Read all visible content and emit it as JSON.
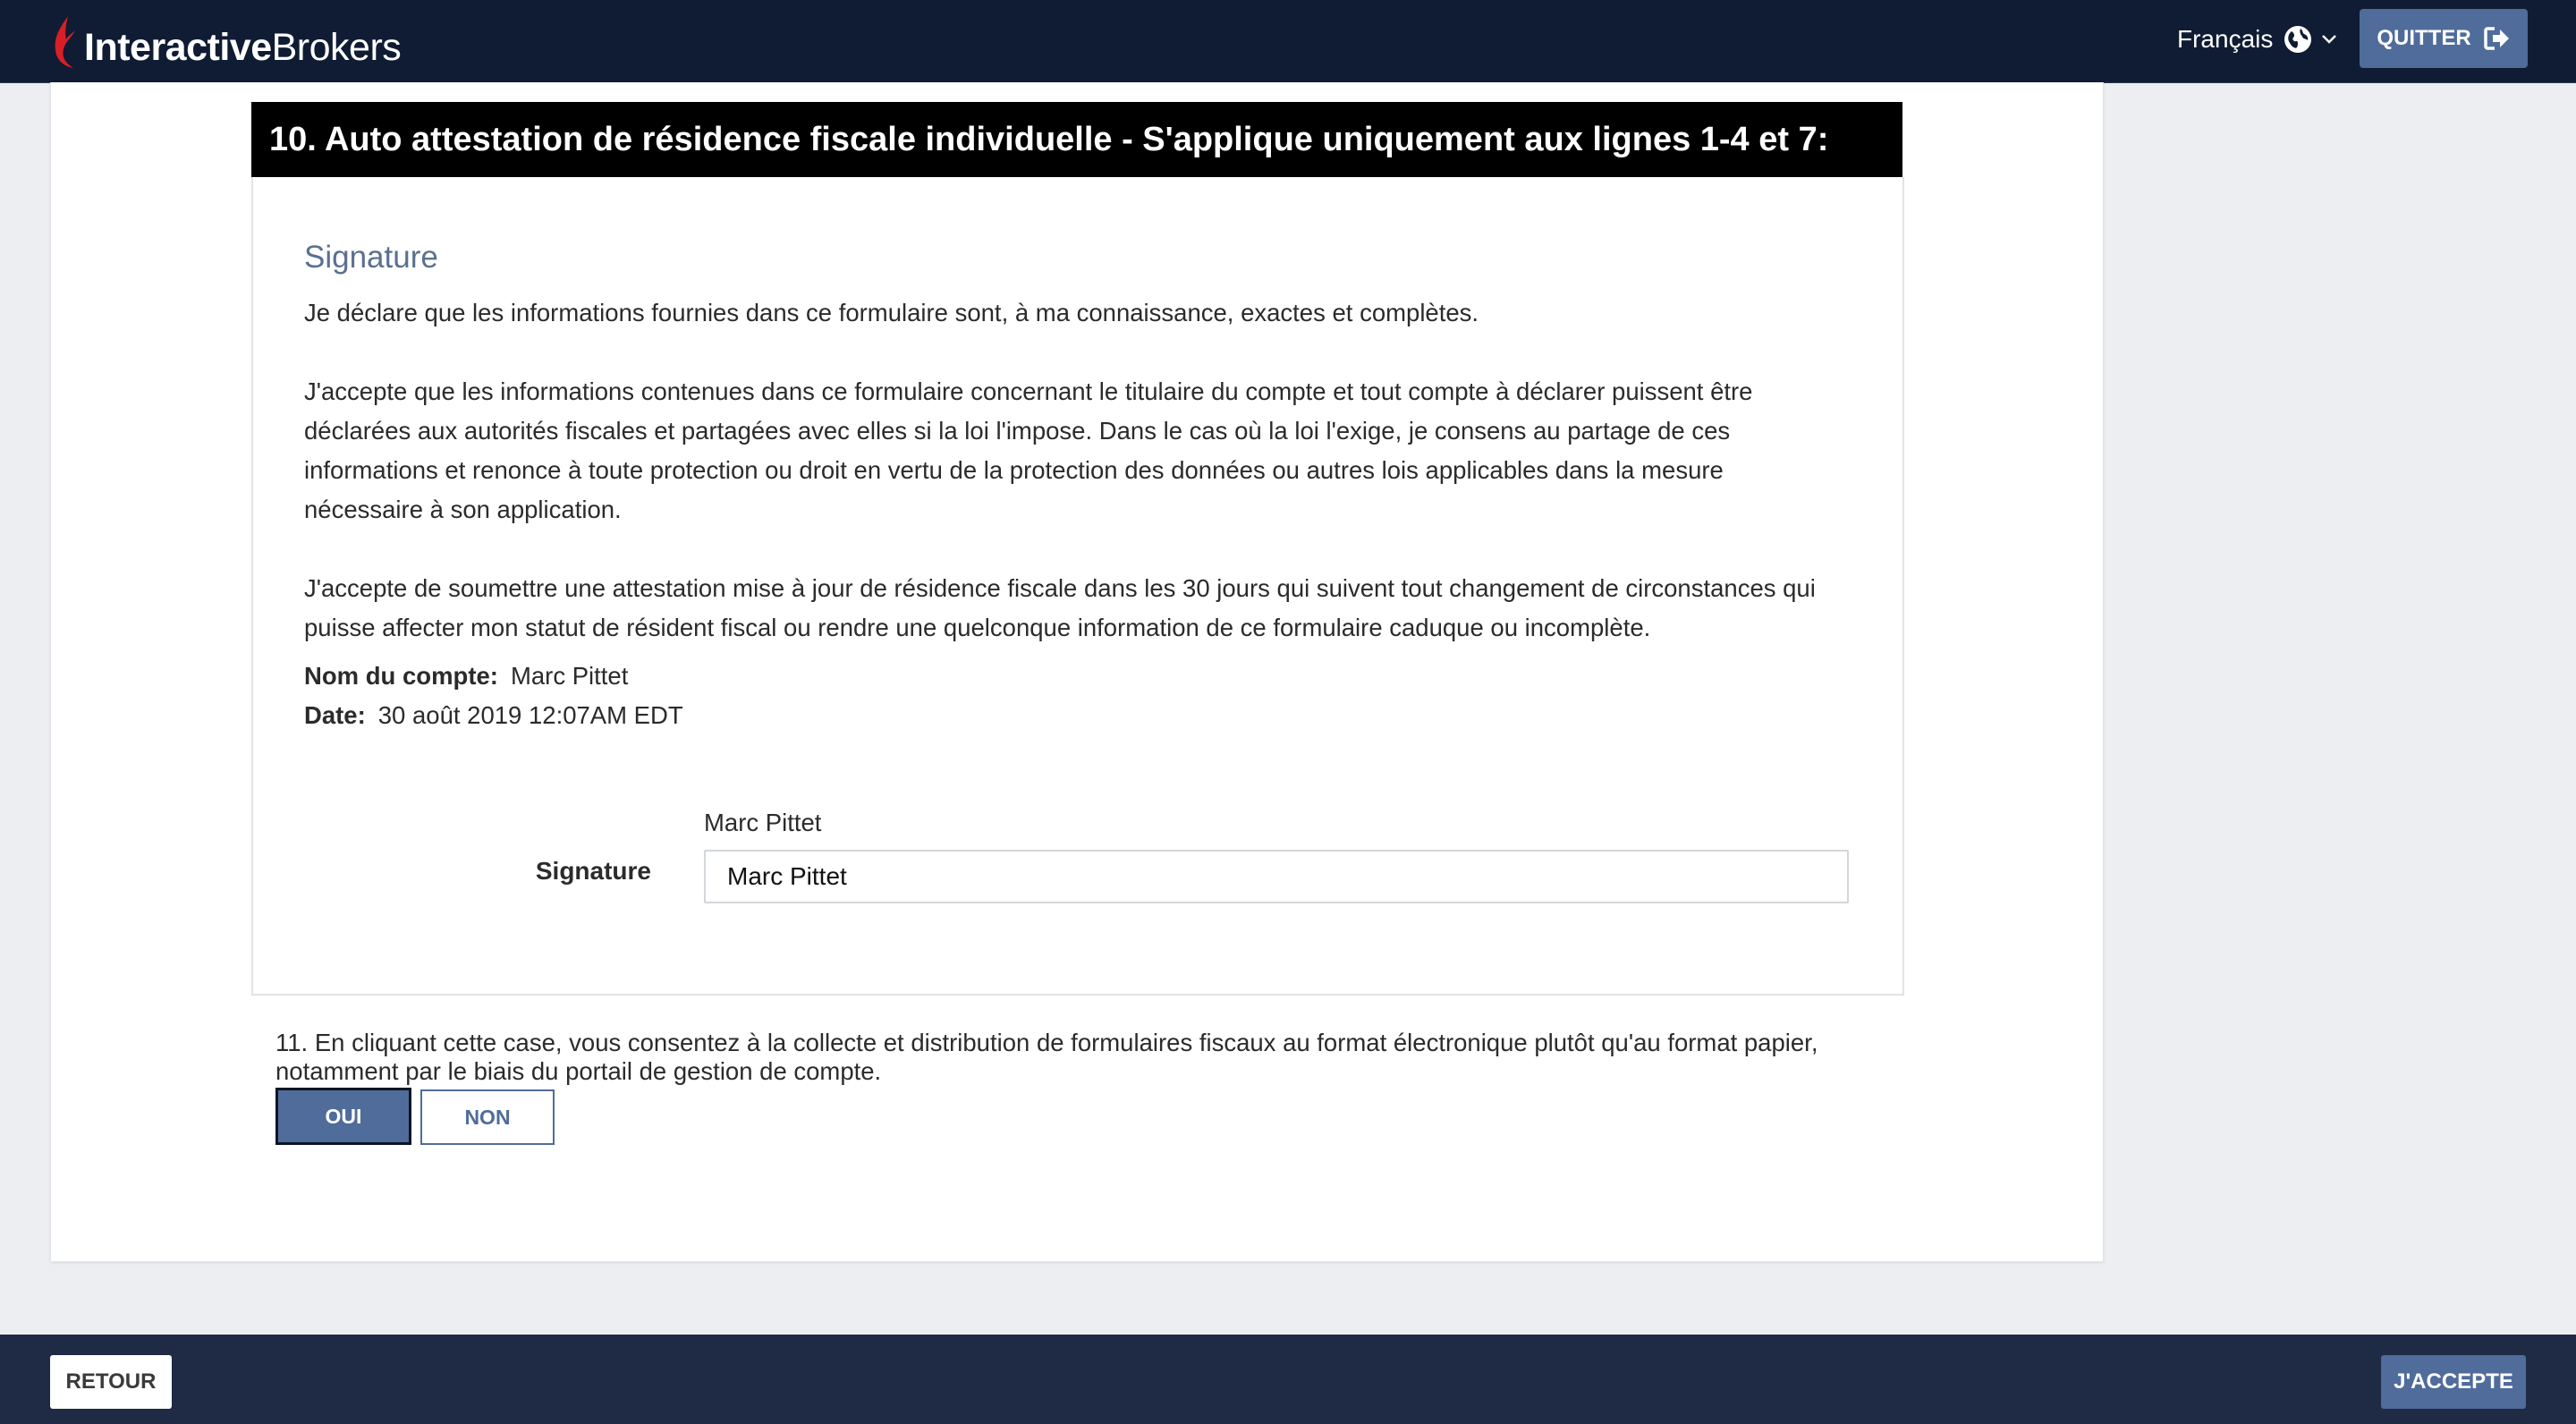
{
  "header": {
    "brand_bold": "Interactive",
    "brand_light": "Brokers",
    "language": "Français",
    "quit_label": "QUITTER"
  },
  "section10": {
    "title": "10. Auto attestation de résidence fiscale individuelle - S'applique uniquement aux lignes 1-4 et 7:",
    "signature_heading": "Signature",
    "para1": "Je déclare que les informations fournies dans ce formulaire sont, à ma connaissance, exactes et complètes.",
    "para2": "J'accepte que les informations contenues dans ce formulaire concernant le titulaire du compte et tout compte à déclarer puissent être déclarées aux autorités fiscales et partagées avec elles si la loi l'impose. Dans le cas où la loi l'exige, je consens au partage de ces informations et renonce à toute protection ou droit en vertu de la protection des données ou autres lois applicables dans la mesure nécessaire à son application.",
    "para3": "J'accepte de soumettre une attestation mise à jour de résidence fiscale dans les 30 jours qui suivent tout changement de circonstances qui puisse affecter mon statut de résident fiscal ou rendre une quelconque information de ce formulaire caduque ou incomplète.",
    "account_name_label": "Nom du compte:",
    "account_name_value": "Marc Pittet",
    "date_label": "Date:",
    "date_value": "30 août 2019 12:07AM EDT",
    "signature_expected_name": "Marc Pittet",
    "signature_field_label": "Signature",
    "signature_value": "Marc Pittet"
  },
  "question11": {
    "text": "11. En cliquant cette case, vous consentez à la collecte et distribution de formulaires fiscaux au format électronique plutôt qu'au format papier, notamment par le biais du portail de gestion de compte.",
    "yes_label": "OUI",
    "no_label": "NON",
    "selected": "OUI"
  },
  "footer": {
    "back_label": "RETOUR",
    "accept_label": "J'ACCEPTE"
  },
  "colors": {
    "header_bg": "#101c33",
    "footer_bg": "#1f2a44",
    "accent": "#4f6c9a",
    "brand_red": "#d81f26"
  },
  "icons": {
    "logo": "ib-flame-logo",
    "language": "globe-icon",
    "language_dropdown": "chevron-down-icon",
    "quit": "sign-out-icon"
  }
}
